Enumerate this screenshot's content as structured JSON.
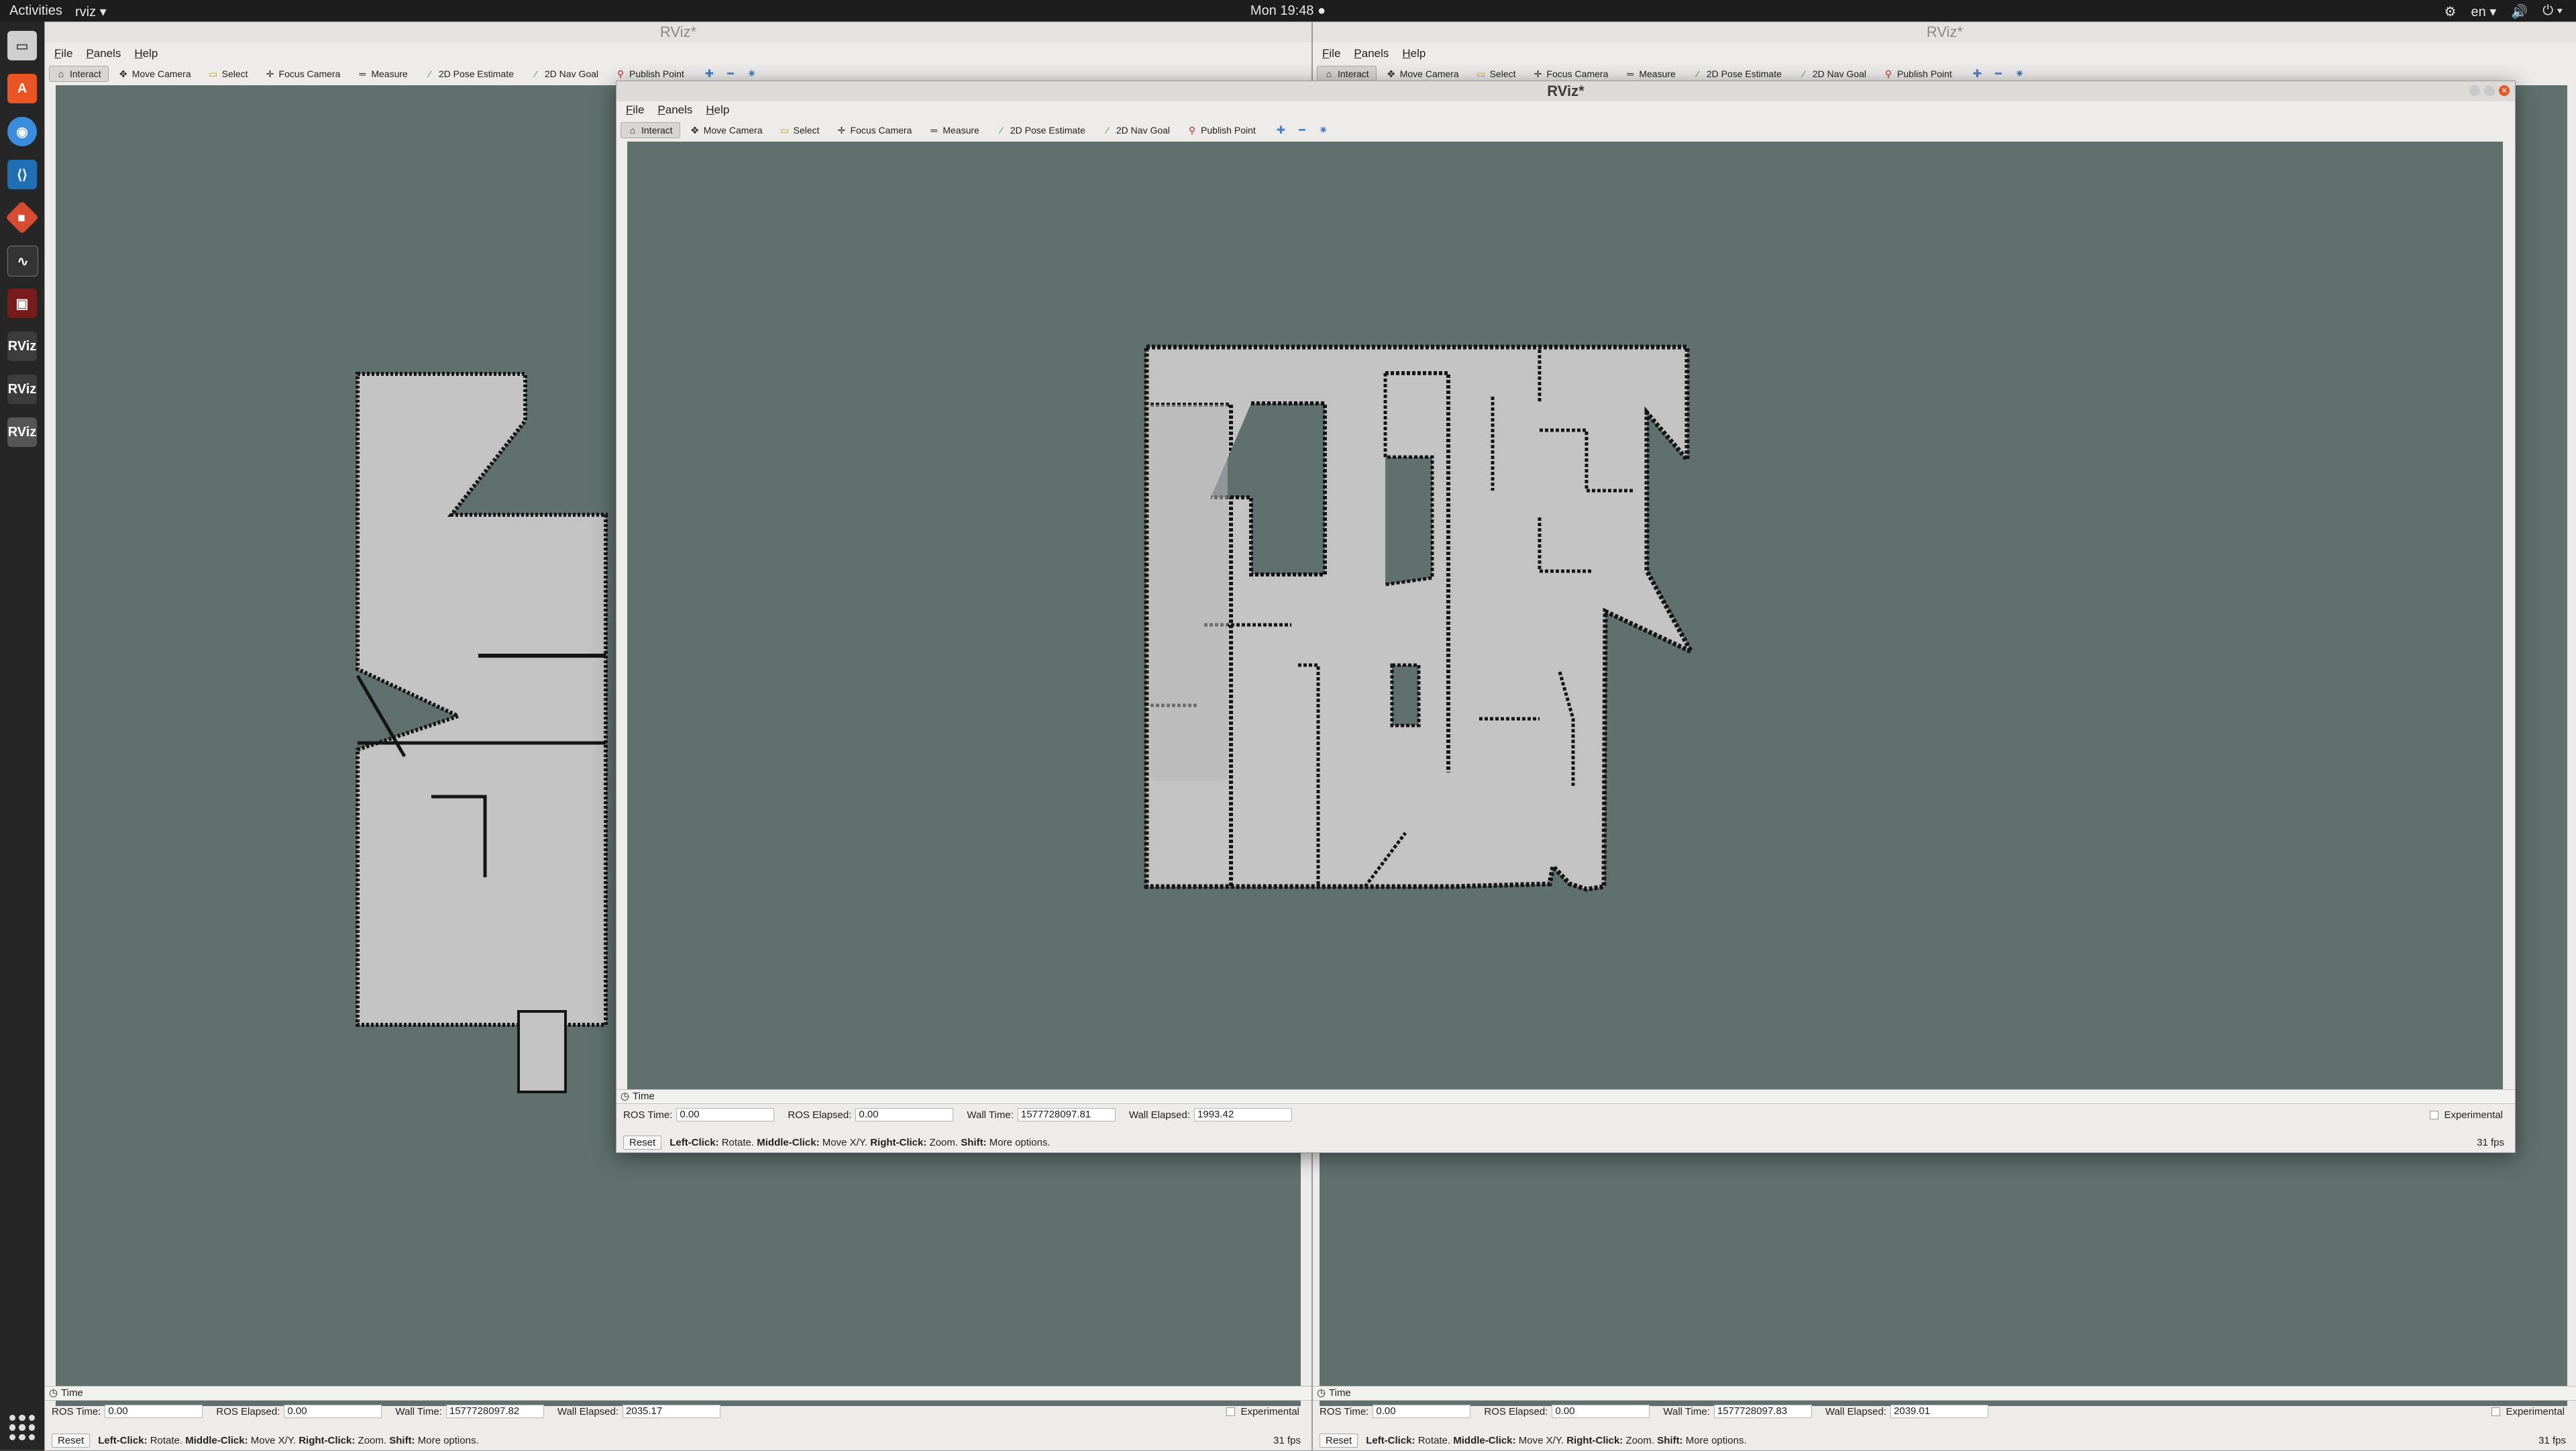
{
  "topbar": {
    "activities": "Activities",
    "app_menu": "rviz ▾",
    "clock": "Mon 19:48 ●",
    "lang": "en ▾",
    "indicators": [
      "⚙",
      "🔊",
      "⏻ ▾"
    ]
  },
  "dock": {
    "icons": [
      "files-icon",
      "software-icon",
      "chrome-icon",
      "vscode-icon",
      "git-icon",
      "system-monitor-icon",
      "terminal-icon",
      "rviz-icon",
      "rviz-icon",
      "rviz-icon"
    ],
    "rviz_label": "RViz"
  },
  "window_left": {
    "title": "RViz*",
    "menu": [
      "File",
      "Panels",
      "Help"
    ],
    "tools": [
      "Interact",
      "Move Camera",
      "Select",
      "Focus Camera",
      "Measure",
      "2D Pose Estimate",
      "2D Nav Goal",
      "Publish Point"
    ],
    "time_title": "Time",
    "ros_time_label": "ROS Time:",
    "ros_time": "0.00",
    "ros_elapsed_label": "ROS Elapsed:",
    "ros_elapsed": "0.00",
    "wall_time_label": "Wall Time:",
    "wall_time": "1577728097.82",
    "wall_elapsed_label": "Wall Elapsed:",
    "wall_elapsed": "2035.17",
    "experimental": "Experimental",
    "reset": "Reset",
    "fps": "31 fps"
  },
  "window_right": {
    "title": "RViz*",
    "menu": [
      "File",
      "Panels",
      "Help"
    ],
    "tools": [
      "Interact",
      "Move Camera",
      "Select",
      "Focus Camera",
      "Measure",
      "2D Pose Estimate",
      "2D Nav Goal",
      "Publish Point"
    ],
    "time_title": "Time",
    "ros_time_label": "ROS Time:",
    "ros_time": "0.00",
    "ros_elapsed_label": "ROS Elapsed:",
    "ros_elapsed": "0.00",
    "wall_time_label": "Wall Time:",
    "wall_time": "1577728097.83",
    "wall_elapsed_label": "Wall Elapsed:",
    "wall_elapsed": "2039.01",
    "experimental": "Experimental",
    "reset": "Reset",
    "fps": "31 fps"
  },
  "window_front": {
    "title": "RViz*",
    "menu": [
      "File",
      "Panels",
      "Help"
    ],
    "tools": [
      "Interact",
      "Move Camera",
      "Select",
      "Focus Camera",
      "Measure",
      "2D Pose Estimate",
      "2D Nav Goal",
      "Publish Point"
    ],
    "time_title": "Time",
    "ros_time_label": "ROS Time:",
    "ros_time": "0.00",
    "ros_elapsed_label": "ROS Elapsed:",
    "ros_elapsed": "0.00",
    "wall_time_label": "Wall Time:",
    "wall_time": "1577728097.81",
    "wall_elapsed_label": "Wall Elapsed:",
    "wall_elapsed": "1993.42",
    "experimental": "Experimental",
    "reset": "Reset",
    "fps": "31 fps"
  },
  "status_hint": {
    "left_click": "Left-Click:",
    "left_click_action": "Rotate.",
    "middle_click": "Middle-Click:",
    "middle_click_action": "Move X/Y.",
    "right_click": "Right-Click:",
    "right_click_action": "Zoom.",
    "shift": "Shift:",
    "shift_action": "More options."
  },
  "colors": {
    "viewport_bg": "#5f706d",
    "map_free": "#c3c3c3",
    "map_wall": "#1a1a1a",
    "accent_close": "#e95420"
  }
}
